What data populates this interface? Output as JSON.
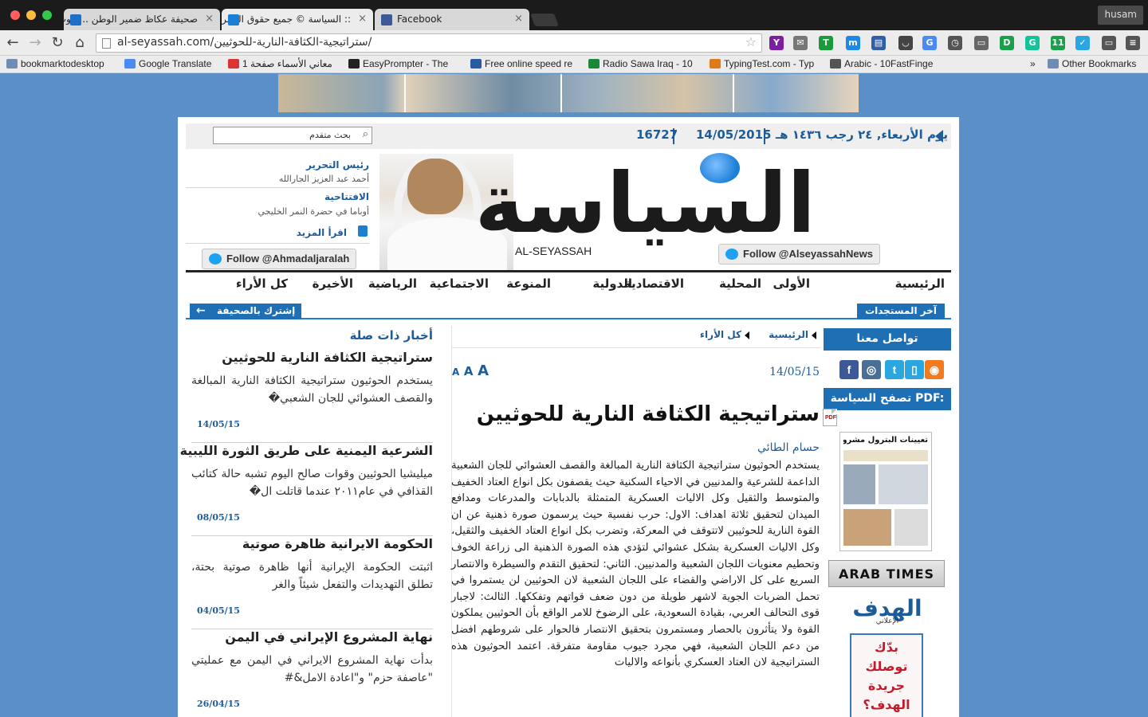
{
  "browser": {
    "tabs": [
      {
        "title": "صحيفة عكاظ ضمير الوطن .. صوت",
        "favicon_color": "#1e6fc9"
      },
      {
        "title": ":: السياسة © جميع حقوق النشر محفوظة",
        "favicon_color": "#1b7fd6"
      },
      {
        "title": "Facebook",
        "favicon_color": "#3b5998"
      }
    ],
    "user_label": "husam",
    "url": "al-seyassah.com/ستراتيجية-الكثافة-النارية-للحوثيين/",
    "extensions": [
      {
        "icon": "yahoo-icon",
        "color": "#7b1fa2",
        "label": "Y"
      },
      {
        "icon": "mail-icon",
        "color": "#777",
        "label": "✉"
      },
      {
        "icon": "translate-icon",
        "color": "#1a9b3a",
        "label": "T"
      },
      {
        "icon": "messenger-icon",
        "color": "#1e88e5",
        "label": "m"
      },
      {
        "icon": "chart-icon",
        "color": "#2f5fa8",
        "label": "▤"
      },
      {
        "icon": "pocket-icon",
        "color": "#444",
        "label": "◡"
      },
      {
        "icon": "google-translate-icon",
        "color": "#4a8af4",
        "label": "G"
      },
      {
        "icon": "clock-icon",
        "color": "#555",
        "label": "◷"
      },
      {
        "icon": "cast-icon",
        "color": "#666",
        "label": "▭"
      },
      {
        "icon": "circle-d-icon",
        "color": "#1aa04a",
        "label": "D"
      },
      {
        "icon": "grammarly-icon",
        "color": "#15c39a",
        "label": "G"
      },
      {
        "icon": "badge-icon",
        "color": "#1aa04a",
        "label": "11"
      },
      {
        "icon": "check-icon",
        "color": "#2aa6e0",
        "label": "✓"
      },
      {
        "icon": "screen-icon",
        "color": "#555",
        "label": "▭"
      },
      {
        "icon": "menu-icon",
        "color": "#555",
        "label": "≡"
      }
    ],
    "bookmarks": [
      {
        "label": "bookmarktodesktop",
        "icon": "folder-icon",
        "color": "#6f8db3"
      },
      {
        "label": "Google Translate",
        "icon": "google-translate-icon",
        "color": "#4a8af4"
      },
      {
        "label": "معاني الأسماء صفحة 1",
        "icon": "page-icon",
        "color": "#d33"
      },
      {
        "label": "EasyPrompter - The",
        "icon": "ep-icon",
        "color": "#222"
      },
      {
        "label": "Free online speed re",
        "icon": "speed-icon",
        "color": "#2b5aa5"
      },
      {
        "label": "Radio Sawa Iraq - 10",
        "icon": "radio-icon",
        "color": "#1a8a3a"
      },
      {
        "label": "TypingTest.com - Typ",
        "icon": "typing-icon",
        "color": "#e07a1f"
      },
      {
        "label": "Arabic - 10FastFinge",
        "icon": "fastfingers-icon",
        "color": "#555"
      }
    ],
    "overflow_label": "»",
    "other_bookmarks": "Other Bookmarks"
  },
  "header": {
    "search_placeholder": "بحث متقدم",
    "issue_number": "16727",
    "date_greg": "14/05/2015",
    "date_hijri": "يوم الأربعاء, ٢٤ رجب ١٤٣٦ هـ",
    "masthead": "السياسة",
    "masthead_latin": "AL-SEYASSAH",
    "follow_paper": "Follow @AlseyassahNews",
    "follow_editor": "Follow @Ahmadaljaralah"
  },
  "editor": {
    "role": "رئيس التحرير",
    "name": "أحمد عبد العزيز الجارالله",
    "editorial_label": "الافتتاحية",
    "editorial_title": "أوباما في حضرة النمر الخليجي",
    "read_more": "اقرأ المزيد"
  },
  "nav": {
    "items": [
      "الرئيسية",
      "الأولى",
      "المحلية",
      "الاقتصادية",
      "الدولية",
      "المنوعة",
      "الاجتماعية",
      "الرياضية",
      "الأخيرة",
      "كل الأراء"
    ]
  },
  "ticker": {
    "latest": "آخر المستجدات",
    "subscribe": "إشترك بالصحيفة"
  },
  "rail": {
    "contact": "تواصل معنا",
    "social": [
      {
        "icon": "rss-icon",
        "color": "#f37a1f",
        "label": "◉"
      },
      {
        "icon": "mobile-icon",
        "color": "#2aa6e0",
        "label": "▯"
      },
      {
        "icon": "twitter-icon",
        "color": "#2aa6e0",
        "label": "t"
      },
      {
        "icon": "instagram-icon",
        "color": "#4a6f95",
        "label": "◎"
      },
      {
        "icon": "facebook-icon",
        "color": "#3b5998",
        "label": "f"
      }
    ],
    "pdf_label": "تصفح السياسة PDF:",
    "pdf_headline": "تعيينات البترول مشروع أزمة سياسية",
    "arab_times": "ARAB TIMES",
    "alhadaf": "الهدف",
    "alhadaf_sub": "الإعلاني",
    "ad_lines": [
      "بدّك",
      "توصلك",
      "جريدة",
      "الهدف؟"
    ]
  },
  "article": {
    "breadcrumb": [
      "الرئيسية",
      "كل الأراء"
    ],
    "font_sizes": [
      "A",
      "A",
      "A"
    ],
    "date": "14/05/15",
    "title": "ستراتيجية الكثافة النارية للحوثيين",
    "author": "حسام الطائي",
    "body": "يستخدم الحوثيون ستراتيجية الكثافة النارية المبالغة والقصف العشوائي للجان الشعبية الداعمة للشرعية والمدنيين في الاحياء السكنية حيث يقصفون بكل انواع العتاد الخفيف والمتوسط والثقيل وكل الاليات العسكرية المتمثلة بالدبابات والمدرعات ومدافع الميدان لتحقيق ثلاثة اهداف: الاول: حرب نفسية حيث يرسمون صورة ذهنية عن ان القوة النارية للحوثيين لاتتوقف في المعركة، وتضرب بكل انواع العتاد الخفيف والثقيل، وكل الاليات العسكرية بشكل عشوائي لتؤدي هذه الصورة الذهنية الى زراعة الخوف وتحطيم معنويات اللجان الشعبية والمدنيين. الثاني: لتحقيق التقدم والسيطرة والانتصار السريع على كل الاراضي والقضاء على اللجان الشعبية لان الحوثيين لن يستمروا في تحمل الضربات الجوية لاشهر طويلة من دون ضعف قواتهم وتفككها. الثالث: لاجبار قوى التحالف العربي، بقيادة السعودية، على الرضوخ للامر الواقع بأن الحوثيين يملكون القوة ولا يتأثرون بالحصار ومستمرون بتحقيق الانتصار فالحوار على شروطهم افضل من دعم اللجان الشعبية، فهي مجرد جيوب مقاومة متفرقة. اعتمد الحوثيون هذه الستراتيجية لان العتاد العسكري بأنواعه والاليات"
  },
  "related": {
    "heading": "أخبار ذات صلة",
    "items": [
      {
        "title": "ستراتيجية الكثافة النارية للحوثيين",
        "snippet": "يستخدم الحوثيون ستراتيجية الكثافة النارية المبالغة والقصف العشوائي للجان الشعبي�",
        "date": "14/05/15"
      },
      {
        "title": "الشرعية اليمنية على طريق الثورة الليبية",
        "snippet": "ميليشيا الحوثيين وقوات صالح اليوم تشبه حالة كتائب القذافي في عام٢٠١١ عندما قاتلت ال�",
        "date": "08/05/15"
      },
      {
        "title": "الحكومة الايرانية ظاهرة صوتية",
        "snippet": "اثبتت الحكومة الإيرانية أنها ظاهرة صوتية بحتة، تطلق التهديدات والتفعل شيئاً والغر",
        "date": "04/05/15"
      },
      {
        "title": "نهاية المشروع الإيراني في اليمن",
        "snippet": "بدأت نهاية المشروع الايراني في اليمن مع عمليتي \"عاصفة حزم\" و\"اعادة الامل&#",
        "date": "26/04/15"
      }
    ]
  }
}
